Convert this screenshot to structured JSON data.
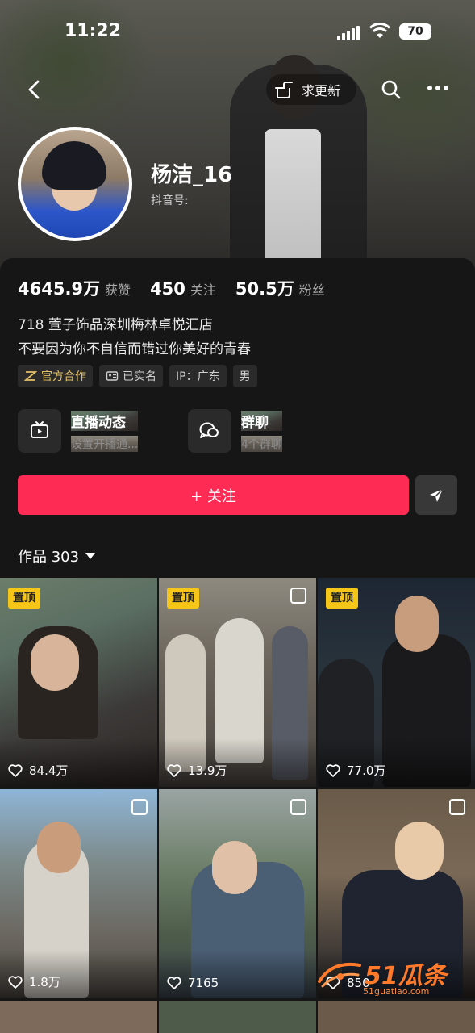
{
  "status_bar": {
    "time": "11:22",
    "battery": "70"
  },
  "top_nav": {
    "request_update_label": "求更新"
  },
  "profile": {
    "nickname": "杨洁_16",
    "douyin_id_label": "抖音号:",
    "stats": [
      {
        "value": "4645.9万",
        "label": "获赞"
      },
      {
        "value": "450",
        "label": "关注"
      },
      {
        "value": "50.5万",
        "label": "粉丝"
      }
    ],
    "bio": [
      "718 萱子饰品深圳梅林卓悦汇店",
      "不要因为你不自信而错过你美好的青春"
    ],
    "tags": [
      {
        "label": "官方合作",
        "icon": "official-cooperation-icon"
      },
      {
        "label": "已实名",
        "icon": "id-card-icon"
      },
      {
        "label": "IP：广东"
      },
      {
        "label": "男"
      }
    ]
  },
  "cards": [
    {
      "title": "直播动态",
      "subtitle": "设置开播通...",
      "icon": "tv-icon"
    },
    {
      "title": "群聊",
      "subtitle": "4个群聊",
      "icon": "chat-bubble-icon"
    }
  ],
  "actions": {
    "follow_label": "+ 关注"
  },
  "works": {
    "label": "作品 303"
  },
  "videos": [
    {
      "pinned": "置顶",
      "likes": "84.4万"
    },
    {
      "pinned": "置顶",
      "likes": "13.9万",
      "multi": true
    },
    {
      "pinned": "置顶",
      "likes": "77.0万"
    },
    {
      "likes": "1.8万",
      "multi": true
    },
    {
      "likes": "7165",
      "multi": true
    },
    {
      "likes": "850",
      "multi": true
    }
  ],
  "watermark": {
    "brand": "51瓜条",
    "url": "51guatiao.com"
  },
  "colors": {
    "accent": "#fe2c55",
    "pin": "#f5c518",
    "background": "#161616"
  }
}
